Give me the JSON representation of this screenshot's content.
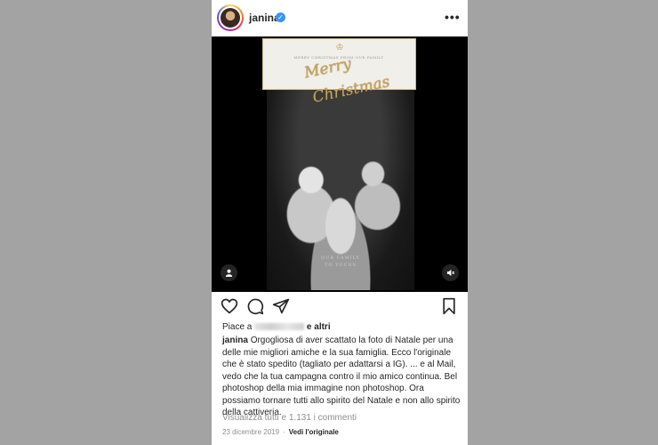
{
  "header": {
    "username": "janina",
    "verified_mark": "✓",
    "more_glyph": "•••"
  },
  "media": {
    "card_small_text": "MERRY CHRISTMAS FROM OUR FAMILY",
    "merry": "Merry",
    "christmas": "Christmas",
    "card_footer_line1": "OUR FAMILY",
    "card_footer_line2": "TO YOURS",
    "tag_icon": "person-icon",
    "mute_icon": "speaker-icon"
  },
  "actions": {
    "icons": [
      "heart-icon",
      "comment-icon",
      "share-icon",
      "bookmark-icon"
    ]
  },
  "likes": {
    "prefix": "Piace a",
    "suffix": "e altri"
  },
  "caption": {
    "author": "janina",
    "text": "Orgogliosa di aver scattato la foto di Natale per una delle mie migliori amiche e la sua famiglia. Ecco l'originale che è stato spedito (tagliato per adattarsi a IG). ... e al Mail, vedo che la tua campagna contro il mio amico continua. Bel photoshop della mia immagine non photoshop. Ora possiamo tornare tutti allo spirito del Natale e non allo spirito della cattiveria."
  },
  "comments": {
    "link": "Visualizza tutti e 1.131 i commenti"
  },
  "footer": {
    "date": "23 dicembre 2019",
    "separator": "·",
    "original_link": "Vedi l'originale"
  },
  "colors": {
    "page_bg": "#a3a3a3",
    "gold": "#c9a55c",
    "verified": "#3897f0"
  }
}
